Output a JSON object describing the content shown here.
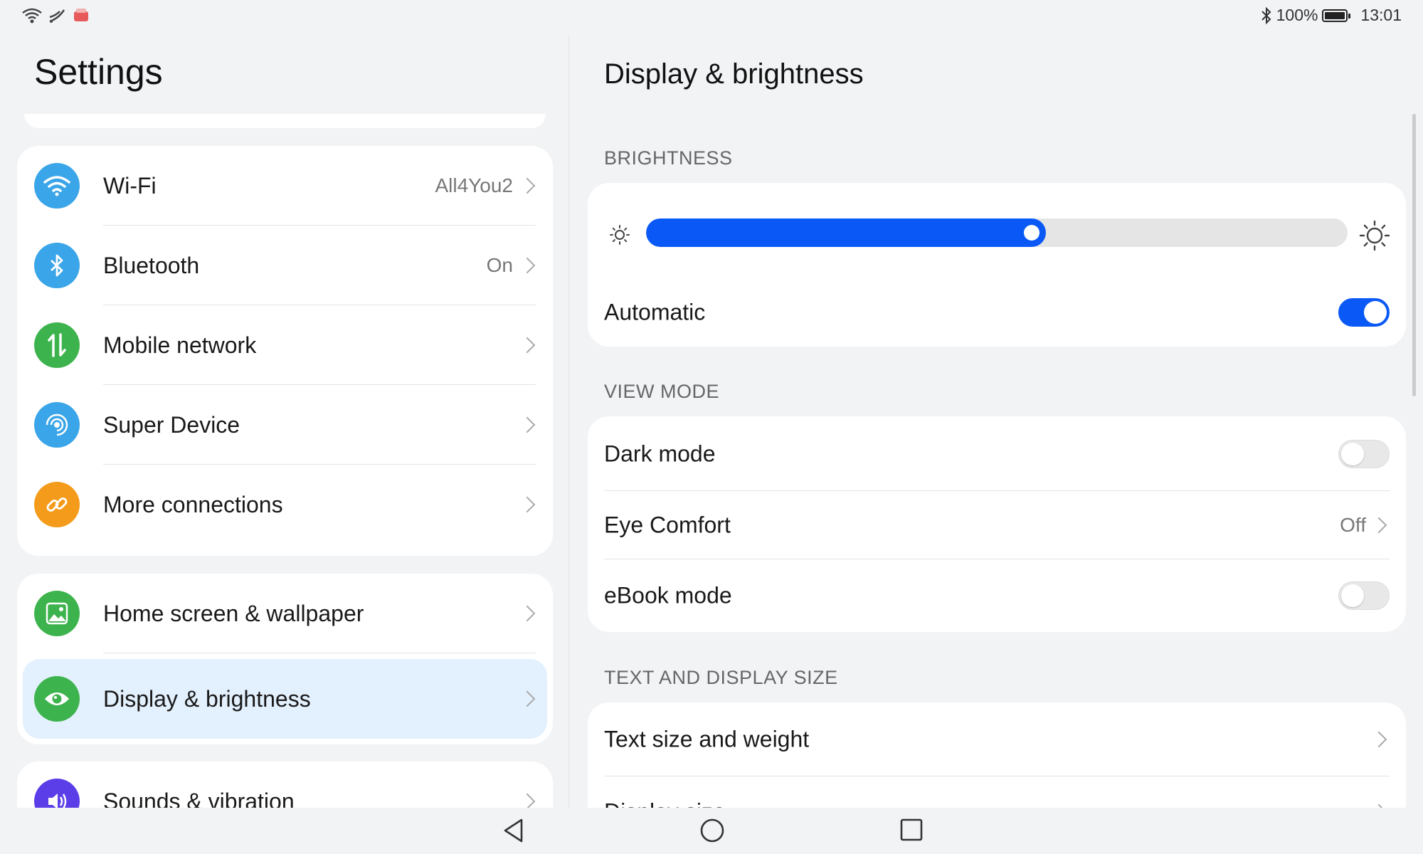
{
  "status_bar": {
    "battery_percent": "100%",
    "time": "13:01",
    "icons": [
      "wifi-icon",
      "cast-icon",
      "app-notification-icon",
      "bluetooth-icon",
      "battery-icon"
    ]
  },
  "left": {
    "title": "Settings",
    "group1": [
      {
        "label": "Wi-Fi",
        "value": "All4You2",
        "icon": "wifi-icon",
        "color": "#3aa5e8"
      },
      {
        "label": "Bluetooth",
        "value": "On",
        "icon": "bluetooth-icon",
        "color": "#3aa5e8"
      },
      {
        "label": "Mobile network",
        "value": "",
        "icon": "mobile-data-icon",
        "color": "#3db34d"
      },
      {
        "label": "Super Device",
        "value": "",
        "icon": "super-device-icon",
        "color": "#3aa5e8"
      },
      {
        "label": "More connections",
        "value": "",
        "icon": "link-icon",
        "color": "#f59b1c"
      }
    ],
    "group2": [
      {
        "label": "Home screen & wallpaper",
        "icon": "wallpaper-icon",
        "color": "#3db34d"
      },
      {
        "label": "Display & brightness",
        "icon": "eye-icon",
        "color": "#3db34d",
        "selected": true
      }
    ],
    "group3": [
      {
        "label": "Sounds & vibration",
        "icon": "speaker-icon",
        "color": "#5b3ee8"
      }
    ]
  },
  "right": {
    "title": "Display & brightness",
    "brightness_section": "BRIGHTNESS",
    "brightness_level": 0.57,
    "automatic_label": "Automatic",
    "automatic_on": true,
    "view_mode_section": "VIEW MODE",
    "dark_mode_label": "Dark mode",
    "eye_comfort_label": "Eye Comfort",
    "eye_comfort_value": "Off",
    "ebook_label": "eBook mode",
    "text_section": "TEXT AND DISPLAY SIZE",
    "text_size_label": "Text size and weight",
    "display_size_label": "Display size"
  },
  "colors": {
    "accent": "#0a59f7",
    "selected_row": "#e3f0fd"
  }
}
